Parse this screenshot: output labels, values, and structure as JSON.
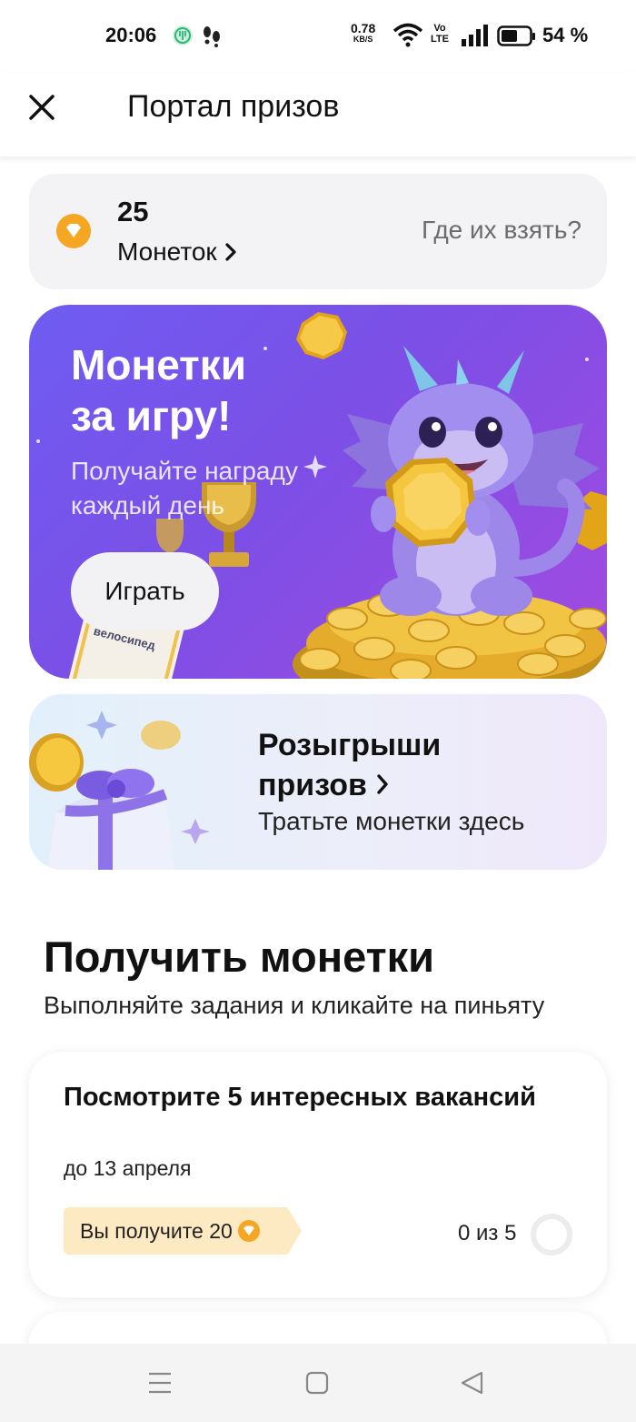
{
  "status_bar": {
    "time": "20:06",
    "net_speed_value": "0.78",
    "net_speed_unit": "KB/S",
    "volte_top": "Vo",
    "volte_bottom": "LTE",
    "battery_percent": "54 %",
    "icons": [
      "app-notification-icon",
      "steps-icon",
      "wifi-icon",
      "signal-icon",
      "battery-icon"
    ]
  },
  "header": {
    "title": "Портал призов",
    "close_icon": "close-icon"
  },
  "coins": {
    "count": "25",
    "label": "Монеток",
    "help_link": "Где их взять?",
    "accent_color": "#f5a623"
  },
  "game_banner": {
    "title_line1": "Монетки",
    "title_line2": "за игру!",
    "subtitle_line1": "Получайте награду",
    "subtitle_line2": "каждый день",
    "button_label": "Играть",
    "bike_card_text": "велосипед",
    "gradient_start": "#6f5cf2",
    "gradient_end": "#a34ae0"
  },
  "prizes_card": {
    "title_line1": "Розыгрыши",
    "title_line2": "призов",
    "subtitle": "Тратьте монетки здесь"
  },
  "earn_section": {
    "title": "Получить монетки",
    "subtitle": "Выполняйте задания и кликайте на пиньяту"
  },
  "tasks": [
    {
      "title": "Посмотрите 5 интересных вакансий",
      "deadline": "до 13 апреля",
      "reward_label": "Вы получите 20",
      "progress_text": "0 из 5",
      "progress_done": 0,
      "progress_total": 5
    }
  ],
  "nav_bar": {
    "icons": [
      "menu-icon",
      "home-square-icon",
      "back-triangle-icon"
    ]
  }
}
